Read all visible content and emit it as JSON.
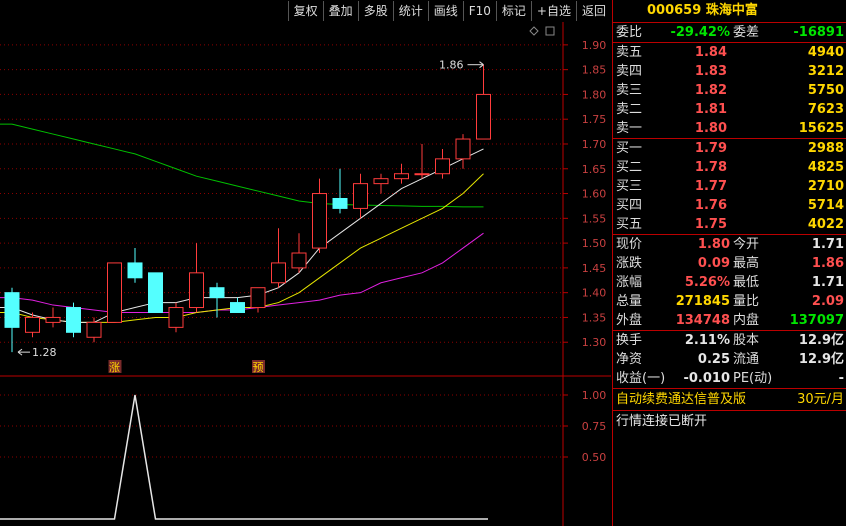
{
  "toolbar": [
    "复权",
    "叠加",
    "多股",
    "统计",
    "画线",
    "F10",
    "标记",
    "+自选",
    "返回"
  ],
  "stock": {
    "code": "000659",
    "name": "珠海中富"
  },
  "weibi": {
    "label1": "委比",
    "value1": "-29.42%",
    "label2": "委差",
    "value2": "-16891"
  },
  "sell_orders": [
    {
      "label": "卖五",
      "price": "1.84",
      "volume": "4940"
    },
    {
      "label": "卖四",
      "price": "1.83",
      "volume": "3212"
    },
    {
      "label": "卖三",
      "price": "1.82",
      "volume": "5750"
    },
    {
      "label": "卖二",
      "price": "1.81",
      "volume": "7623"
    },
    {
      "label": "卖一",
      "price": "1.80",
      "volume": "15625"
    }
  ],
  "buy_orders": [
    {
      "label": "买一",
      "price": "1.79",
      "volume": "2988"
    },
    {
      "label": "买二",
      "price": "1.78",
      "volume": "4825"
    },
    {
      "label": "买三",
      "price": "1.77",
      "volume": "2710"
    },
    {
      "label": "买四",
      "price": "1.76",
      "volume": "5714"
    },
    {
      "label": "买五",
      "price": "1.75",
      "volume": "4022"
    }
  ],
  "quote": [
    {
      "l1": "现价",
      "v1": "1.80",
      "c1": "red",
      "l2": "今开",
      "v2": "1.71",
      "c2": "white"
    },
    {
      "l1": "涨跌",
      "v1": "0.09",
      "c1": "red",
      "l2": "最高",
      "v2": "1.86",
      "c2": "red"
    },
    {
      "l1": "涨幅",
      "v1": "5.26%",
      "c1": "red",
      "l2": "最低",
      "v2": "1.71",
      "c2": "white"
    },
    {
      "l1": "总量",
      "v1": "271845",
      "c1": "ad",
      "l2": "量比",
      "v2": "2.09",
      "c2": "red"
    },
    {
      "l1": "外盘",
      "v1": "134748",
      "c1": "red",
      "l2": "内盘",
      "v2": "137097",
      "c2": "green"
    }
  ],
  "stats": [
    {
      "l1": "换手",
      "v1": "2.11%",
      "l2": "股本",
      "v2": "12.9亿"
    },
    {
      "l1": "净资",
      "v1": "0.25",
      "l2": "流通",
      "v2": "12.9亿"
    },
    {
      "l1": "收益(一)",
      "v1": "-0.010",
      "l2": "PE(动)",
      "v2": "-"
    }
  ],
  "ad": {
    "text": "自动续费通达信普及版",
    "price": "30元/月"
  },
  "status": "行情连接已断开",
  "chart": {
    "y_ticks": [
      "1.90",
      "1.85",
      "1.80",
      "1.75",
      "1.70",
      "1.65",
      "1.60",
      "1.55",
      "1.50",
      "1.45",
      "1.40",
      "1.35",
      "1.30"
    ],
    "ind_ticks": [
      "1.00",
      "0.75",
      "0.50"
    ],
    "max_label": "1.86",
    "min_label": "1.28",
    "marks": [
      "涨",
      "预"
    ]
  },
  "chart_data": {
    "type": "candlestick",
    "ylim": [
      1.25,
      1.93
    ],
    "candles": [
      {
        "o": 1.4,
        "c": 1.33,
        "h": 1.41,
        "l": 1.28
      },
      {
        "o": 1.32,
        "c": 1.35,
        "h": 1.36,
        "l": 1.31
      },
      {
        "o": 1.34,
        "c": 1.35,
        "h": 1.37,
        "l": 1.33
      },
      {
        "o": 1.37,
        "c": 1.32,
        "h": 1.38,
        "l": 1.31
      },
      {
        "o": 1.31,
        "c": 1.34,
        "h": 1.35,
        "l": 1.3
      },
      {
        "o": 1.34,
        "c": 1.46,
        "h": 1.46,
        "l": 1.34
      },
      {
        "o": 1.46,
        "c": 1.43,
        "h": 1.49,
        "l": 1.42
      },
      {
        "o": 1.44,
        "c": 1.36,
        "h": 1.44,
        "l": 1.36
      },
      {
        "o": 1.33,
        "c": 1.37,
        "h": 1.38,
        "l": 1.32
      },
      {
        "o": 1.37,
        "c": 1.44,
        "h": 1.5,
        "l": 1.36
      },
      {
        "o": 1.41,
        "c": 1.39,
        "h": 1.42,
        "l": 1.35
      },
      {
        "o": 1.38,
        "c": 1.36,
        "h": 1.39,
        "l": 1.36
      },
      {
        "o": 1.37,
        "c": 1.41,
        "h": 1.41,
        "l": 1.36
      },
      {
        "o": 1.42,
        "c": 1.46,
        "h": 1.53,
        "l": 1.41
      },
      {
        "o": 1.45,
        "c": 1.48,
        "h": 1.52,
        "l": 1.44
      },
      {
        "o": 1.49,
        "c": 1.6,
        "h": 1.63,
        "l": 1.48
      },
      {
        "o": 1.59,
        "c": 1.57,
        "h": 1.65,
        "l": 1.56
      },
      {
        "o": 1.57,
        "c": 1.62,
        "h": 1.64,
        "l": 1.55
      },
      {
        "o": 1.62,
        "c": 1.63,
        "h": 1.64,
        "l": 1.6
      },
      {
        "o": 1.63,
        "c": 1.64,
        "h": 1.66,
        "l": 1.62
      },
      {
        "o": 1.64,
        "c": 1.64,
        "h": 1.7,
        "l": 1.63
      },
      {
        "o": 1.64,
        "c": 1.67,
        "h": 1.69,
        "l": 1.63
      },
      {
        "o": 1.67,
        "c": 1.71,
        "h": 1.72,
        "l": 1.65
      },
      {
        "o": 1.71,
        "c": 1.8,
        "h": 1.86,
        "l": 1.71
      }
    ],
    "ma_white": [
      1.37,
      1.355,
      1.345,
      1.34,
      1.34,
      1.36,
      1.37,
      1.38,
      1.38,
      1.39,
      1.39,
      1.39,
      1.395,
      1.41,
      1.44,
      1.49,
      1.52,
      1.55,
      1.58,
      1.61,
      1.63,
      1.65,
      1.67,
      1.69
    ],
    "ma_yellow": [
      1.36,
      1.35,
      1.345,
      1.34,
      1.34,
      1.34,
      1.345,
      1.35,
      1.35,
      1.36,
      1.365,
      1.37,
      1.37,
      1.38,
      1.4,
      1.43,
      1.46,
      1.49,
      1.51,
      1.53,
      1.55,
      1.57,
      1.6,
      1.64
    ],
    "ma_magenta": [
      1.39,
      1.385,
      1.375,
      1.37,
      1.365,
      1.36,
      1.36,
      1.36,
      1.36,
      1.36,
      1.365,
      1.365,
      1.37,
      1.375,
      1.38,
      1.385,
      1.395,
      1.4,
      1.42,
      1.43,
      1.44,
      1.46,
      1.49,
      1.52
    ],
    "ma_green": [
      1.74,
      1.73,
      1.72,
      1.71,
      1.7,
      1.69,
      1.68,
      1.665,
      1.65,
      1.635,
      1.625,
      1.615,
      1.605,
      1.595,
      1.585,
      1.58,
      1.578,
      1.577,
      1.576,
      1.575,
      1.574,
      1.574,
      1.573,
      1.573
    ],
    "indicator": [
      0,
      0,
      0,
      0,
      0,
      0,
      1,
      0,
      0,
      0,
      0,
      0,
      0,
      0,
      0,
      0,
      0,
      0,
      0,
      0,
      0,
      0,
      0,
      0
    ]
  }
}
